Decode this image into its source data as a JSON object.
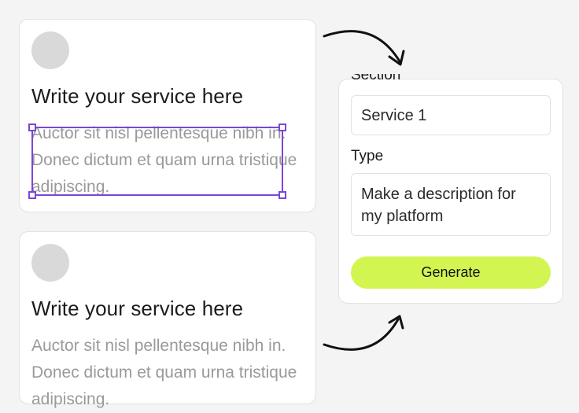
{
  "cards": [
    {
      "title": "Write your service here",
      "description": "Auctor sit nisl pellentesque nibh in. Donec dictum et quam urna tristique adipiscing."
    },
    {
      "title": "Write your service here",
      "description": "Auctor sit nisl pellentesque nibh in. Donec dictum et quam urna tristique adipiscing."
    }
  ],
  "panel": {
    "section_label": "Section",
    "section_value": "Service 1",
    "type_label": "Type",
    "type_value": "Make a description for my platform",
    "generate_label": "Generate"
  },
  "colors": {
    "accent_button": "#d2f552",
    "selection": "#7a47d6",
    "placeholder_text": "#9a9a9a"
  },
  "icons": [
    "curved-arrow-icon"
  ]
}
